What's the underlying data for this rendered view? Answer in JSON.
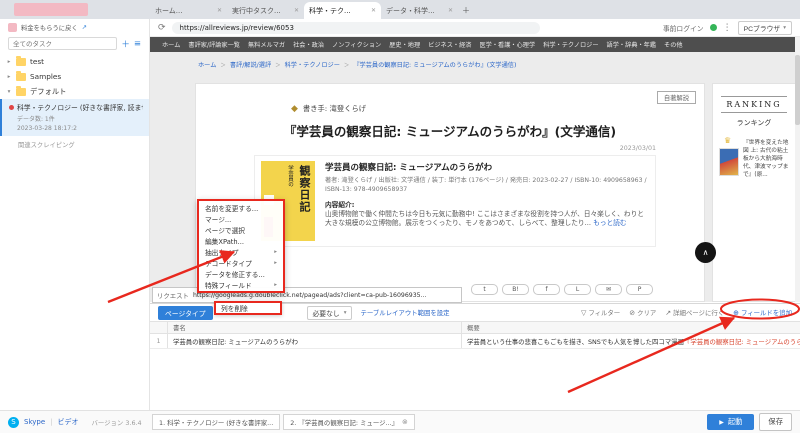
{
  "colors": {
    "accent_blue": "#2f80d9",
    "annotation_red": "#e8281e",
    "link_blue": "#2a66c8",
    "highlight_red": "#d8442e",
    "cover_yellow": "#f3d44c",
    "status_green": "#35b558",
    "skype_blue": "#00aff0"
  },
  "icons": {
    "close": "✕",
    "close_circle": "⊗",
    "new_tab": "＋",
    "refresh": "⟳",
    "more": "⋮",
    "caret_down": "▾",
    "chevron_right": "▸",
    "chevron_down": "▾",
    "chevron_up": "∧",
    "external": "↗",
    "plus": "＋",
    "menu": "≡",
    "diamond": "◆",
    "crown": "♛",
    "breadcrumb_sep": "＞",
    "filter": "▽",
    "clear": "⊘",
    "goto": "↗",
    "add_circle": "⊕",
    "run": "▶",
    "submenu": "▸",
    "skype": "S"
  },
  "titlebar": {
    "upgrade_note": "料金をもらうに戻く",
    "tabs": [
      {
        "label": "ホーム..."
      },
      {
        "label": "実行中タスク..."
      },
      {
        "label": "科学・テク..."
      },
      {
        "label": "データ・科学..."
      }
    ]
  },
  "browser": {
    "url": "https://allreviews.jp/review/6053",
    "pre_login": "事前ログイン",
    "device_mode": "PCブラウザ"
  },
  "sidebar": {
    "search_placeholder": "全てのタスク",
    "folders": [
      {
        "name": "test"
      },
      {
        "name": "Samples"
      },
      {
        "name": "デフォルト"
      }
    ],
    "task": {
      "title": "科学・テクノロジー (好きな書評家, 読ませ...",
      "count": "データ数: 1件",
      "time": "2023-03-28 18:17:2",
      "related": "関連スクレイピング"
    }
  },
  "page": {
    "nav": [
      "ホーム",
      "書評家/評論家一覧",
      "無料メルマガ",
      "社会・政治",
      "ノンフィクション",
      "歴史・地理",
      "ビジネス・経済",
      "医学・看護・心理学",
      "科学・テクノロジー",
      "語学・辞典・年鑑",
      "その他"
    ],
    "breadcrumb": [
      "ホーム",
      "書評/解説/選評",
      "科学・テクノロジー",
      "『学芸員の観察日記: ミュージアムのうらがわ』(文学通信)"
    ],
    "article": {
      "badge": "自著解説",
      "writer": "書き手: 滝登くらげ",
      "title": "『学芸員の観察日記: ミュージアムのうらがわ』(文学通信)",
      "date": "2023/03/01",
      "cover_title": "観察日記",
      "cover_sub": "学芸員の",
      "book_title": "学芸員の観察日記: ミュージアムのうらがわ",
      "book_meta": "著者: 滝登くらげ / 出版社: 文学通信 / 装丁: 単行本 (176ページ) / 発売日: 2023-02-27 / ISBN-10: 4909658963 / ISBN-13: 978-4909658937",
      "intro_label": "内容紹介:",
      "intro": "山奥博物館で働く仲間たちは今日も元気に勤務中! ここはさまざまな役割を持つ人が、日々楽しく、わりと大きな規模の公立博物館。展示をつくったり、モノをあつめて、しらべて、整理したり...",
      "more": "もっと読む"
    },
    "share": [
      {
        "name": "twitter",
        "glyph": "t"
      },
      {
        "name": "hatena",
        "glyph": "B!"
      },
      {
        "name": "facebook",
        "glyph": "f"
      },
      {
        "name": "line",
        "glyph": "L"
      },
      {
        "name": "mail",
        "glyph": "✉"
      },
      {
        "name": "pocket",
        "glyph": "P"
      }
    ],
    "ranking": {
      "en": "RANKING",
      "jp": "ランキング",
      "items": [
        {
          "title": "『世界を変えた地図 上: 古代の粘土板から大航海時代、津波マップまで』(原..."
        }
      ]
    }
  },
  "context_menu": {
    "items": [
      {
        "label": "名前を変更する..."
      },
      {
        "label": "マージ..."
      },
      {
        "label": "ページで選択"
      },
      {
        "label": "編集XPath..."
      },
      {
        "label": "抽出タイプ"
      },
      {
        "label": "デコードタイプ"
      },
      {
        "label": "データを修正する..."
      },
      {
        "label": "特殊フィールド"
      }
    ],
    "delete_column": "列を削除"
  },
  "panel": {
    "request_label": "リクエスト",
    "request_url": "https://googleads.g.doubleclick.net/pagead/ads?client=ca-pub-16096935...",
    "page_type": "ページタイプ",
    "paging": "必要なし",
    "layout_link": "テーブルレイアウト範囲を設定",
    "filter": "フィルター",
    "clear": "クリア",
    "goto_detail": "詳細ページに行く",
    "add_field": "フィールドを追加",
    "columns": [
      "書名",
      "概要"
    ],
    "rows": [
      {
        "no": "1",
        "title": "学芸員の観察日記: ミュージアムのうらがわ",
        "summary": "学芸員という仕事の悲喜こもごもを描き、SNSでも人気を博した四コマ漫画",
        "summary_highlight": "『学芸員の観察日記: ミュージアムのうらがわ』がこのた..."
      }
    ]
  },
  "statusbar": {
    "skype": "Skype",
    "video": "ビデオ",
    "version": "バージョン 3.6.4",
    "tabs": [
      {
        "label": "1. 科学・テクノロジー (好きな書評家..."
      },
      {
        "label": "2. 『学芸員の観察日記: ミュージ...』"
      }
    ],
    "run": "起動",
    "save": "保存"
  }
}
